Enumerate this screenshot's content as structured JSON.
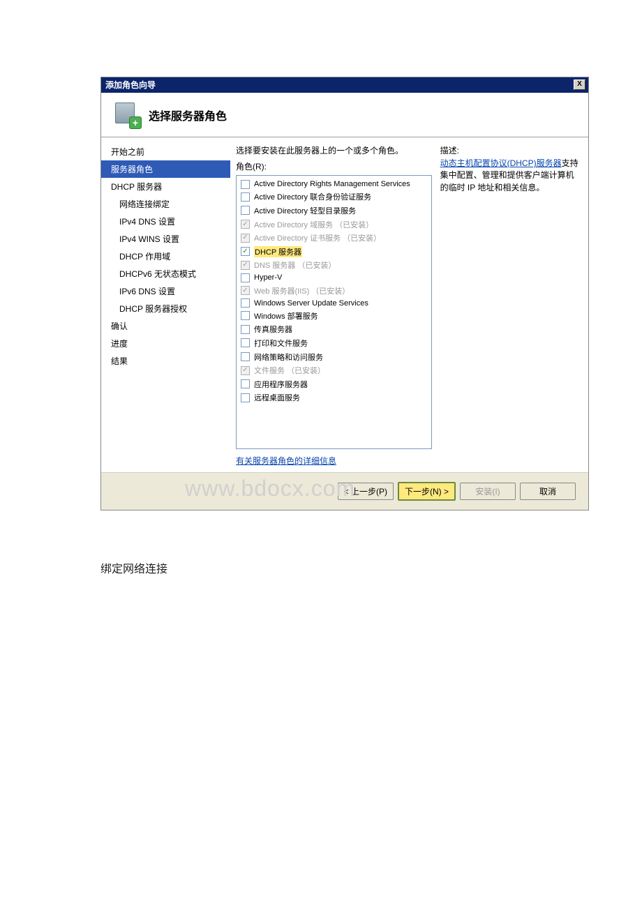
{
  "window": {
    "title": "添加角色向导",
    "close": "X"
  },
  "header": {
    "title": "选择服务器角色",
    "plus": "+"
  },
  "sidebar": {
    "items": [
      {
        "label": "开始之前",
        "indent": false,
        "selected": false
      },
      {
        "label": "服务器角色",
        "indent": false,
        "selected": true
      },
      {
        "label": "DHCP 服务器",
        "indent": false,
        "selected": false
      },
      {
        "label": "网络连接绑定",
        "indent": true,
        "selected": false
      },
      {
        "label": "IPv4 DNS 设置",
        "indent": true,
        "selected": false
      },
      {
        "label": "IPv4 WINS 设置",
        "indent": true,
        "selected": false
      },
      {
        "label": "DHCP 作用域",
        "indent": true,
        "selected": false
      },
      {
        "label": "DHCPv6 无状态模式",
        "indent": true,
        "selected": false
      },
      {
        "label": "IPv6 DNS 设置",
        "indent": true,
        "selected": false
      },
      {
        "label": "DHCP 服务器授权",
        "indent": true,
        "selected": false
      },
      {
        "label": "确认",
        "indent": false,
        "selected": false
      },
      {
        "label": "进度",
        "indent": false,
        "selected": false
      },
      {
        "label": "结果",
        "indent": false,
        "selected": false
      }
    ]
  },
  "main": {
    "instruction": "选择要安装在此服务器上的一个或多个角色。",
    "roles_label": "角色(R):",
    "roles": [
      {
        "label": "Active Directory Rights Management Services",
        "checked": false,
        "disabled": false,
        "highlight": false
      },
      {
        "label": "Active Directory 联合身份验证服务",
        "checked": false,
        "disabled": false,
        "highlight": false
      },
      {
        "label": "Active Directory 轻型目录服务",
        "checked": false,
        "disabled": false,
        "highlight": false
      },
      {
        "label": "Active Directory 域服务 （已安装）",
        "checked": true,
        "disabled": true,
        "highlight": false
      },
      {
        "label": "Active Directory 证书服务 （已安装）",
        "checked": true,
        "disabled": true,
        "highlight": false
      },
      {
        "label": "DHCP 服务器",
        "checked": true,
        "disabled": false,
        "highlight": true
      },
      {
        "label": "DNS 服务器 （已安装）",
        "checked": true,
        "disabled": true,
        "highlight": false
      },
      {
        "label": "Hyper-V",
        "checked": false,
        "disabled": false,
        "highlight": false
      },
      {
        "label": "Web 服务器(IIS) （已安装）",
        "checked": true,
        "disabled": true,
        "highlight": false
      },
      {
        "label": "Windows Server Update Services",
        "checked": false,
        "disabled": false,
        "highlight": false
      },
      {
        "label": "Windows 部署服务",
        "checked": false,
        "disabled": false,
        "highlight": false
      },
      {
        "label": "传真服务器",
        "checked": false,
        "disabled": false,
        "highlight": false
      },
      {
        "label": "打印和文件服务",
        "checked": false,
        "disabled": false,
        "highlight": false
      },
      {
        "label": "网络策略和访问服务",
        "checked": false,
        "disabled": false,
        "highlight": false
      },
      {
        "label": "文件服务 （已安装）",
        "checked": true,
        "disabled": true,
        "highlight": false
      },
      {
        "label": "应用程序服务器",
        "checked": false,
        "disabled": false,
        "highlight": false
      },
      {
        "label": "远程桌面服务",
        "checked": false,
        "disabled": false,
        "highlight": false
      }
    ],
    "more_link": "有关服务器角色的详细信息",
    "desc_label": "描述:",
    "desc_link": "动态主机配置协议(DHCP)服务器",
    "desc_rest": "支持集中配置、管理和提供客户端计算机的临时 IP 地址和相关信息。"
  },
  "footer": {
    "watermark": "www.bdocx.com",
    "back": "< 上一步(P)",
    "next": "下一步(N) >",
    "install": "安装(I)",
    "cancel": "取消"
  },
  "caption": "绑定网络连接"
}
